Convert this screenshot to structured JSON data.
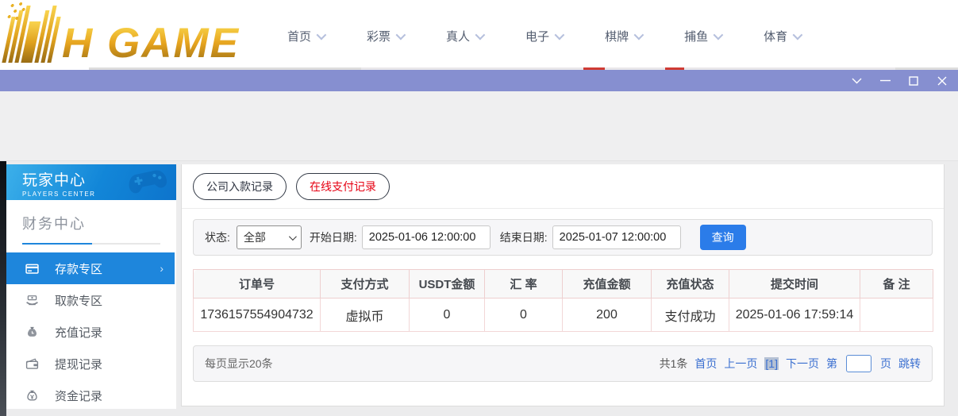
{
  "header": {
    "logo_text": "H GAME",
    "nav": [
      {
        "label": "首页"
      },
      {
        "label": "彩票"
      },
      {
        "label": "真人"
      },
      {
        "label": "电子"
      },
      {
        "label": "棋牌"
      },
      {
        "label": "捕鱼"
      },
      {
        "label": "体育"
      }
    ]
  },
  "sidebar": {
    "title": "玩家中心",
    "subtitle": "PLAYERS CENTER",
    "section_title": "财务中心",
    "items": [
      {
        "label": "存款专区",
        "icon": "deposit-card-icon",
        "active": true,
        "arrow": "›"
      },
      {
        "label": "取款专区",
        "icon": "withdraw-hand-icon",
        "active": false
      },
      {
        "label": "充值记录",
        "icon": "recharge-bag-icon",
        "active": false
      },
      {
        "label": "提现记录",
        "icon": "withdrawal-wallet-icon",
        "active": false
      },
      {
        "label": "资金记录",
        "icon": "funds-bag-icon",
        "active": false
      }
    ]
  },
  "main": {
    "tabs": [
      {
        "label": "公司入款记录",
        "color": "#2f3542",
        "active": false
      },
      {
        "label": "在线支付记录",
        "color": "#e60012",
        "active": true
      }
    ],
    "filters": {
      "status_label": "状态:",
      "status_value": "全部",
      "start_label": "开始日期:",
      "start_value": "2025-01-06 12:00:00",
      "end_label": "结束日期:",
      "end_value": "2025-01-07 12:00:00",
      "query_button": "查询",
      "query_button_color": "#2b7ce9"
    },
    "table": {
      "headers": [
        "订单号",
        "支付方式",
        "USDT金额",
        "汇 率",
        "充值金额",
        "充值状态",
        "提交时间",
        "备 注"
      ],
      "rows": [
        [
          "1736157554904732",
          "虚拟币",
          "0",
          "0",
          "200",
          "支付成功",
          "2025-01-06 17:59:14",
          ""
        ]
      ]
    },
    "pagination": {
      "page_size_text": "每页显示20条",
      "total_text": "共1条",
      "first_label": "首页",
      "prev_label": "上一页",
      "current_label": "[1]",
      "next_label": "下一页",
      "jump_prefix": "第",
      "jump_suffix": "页",
      "jump_button": "跳转",
      "jump_value": "",
      "link_color": "#3a6fd0"
    }
  },
  "colors": {
    "titlebar": "#868fd0",
    "sidebar_active": "#1e86dc",
    "sidebar_header_gradient_start": "#3cb0ea",
    "sidebar_header_gradient_end": "#0d74cc",
    "tab_red": "#e60012",
    "logo_gold": "#e7a51f",
    "table_border_pink": "#f2d7d7"
  }
}
